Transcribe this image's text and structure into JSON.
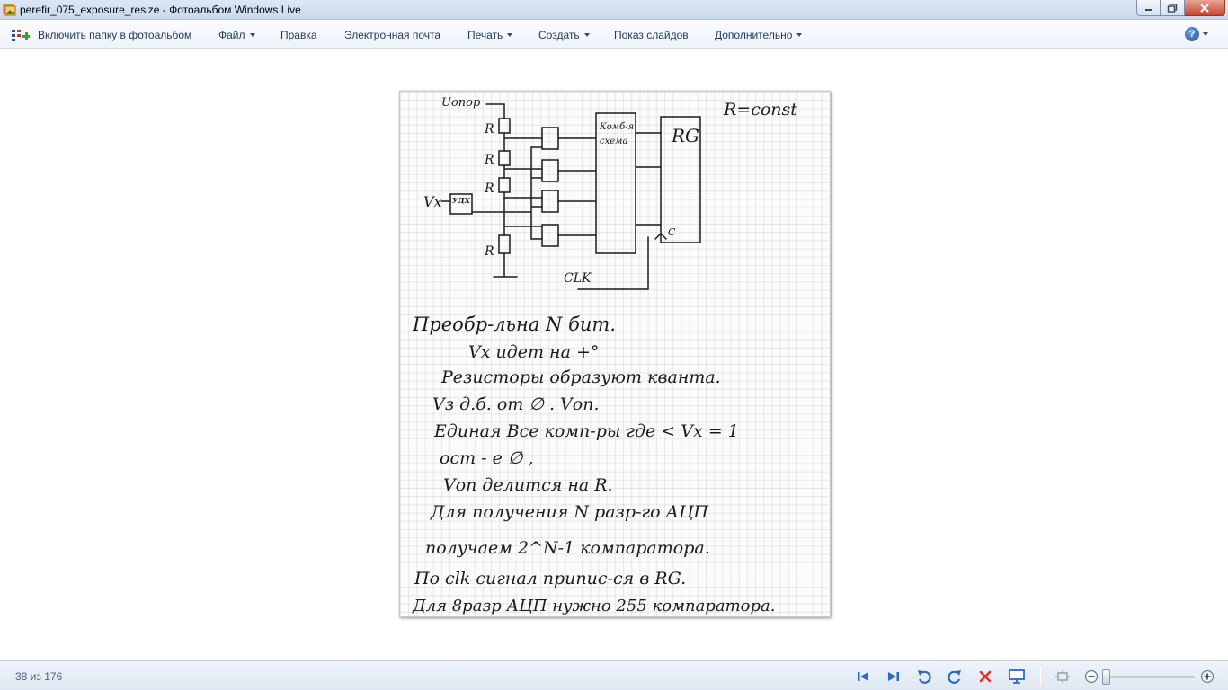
{
  "window": {
    "title": "perefir_075_exposure_resize - Фотоальбом Windows Live"
  },
  "toolbar": {
    "include_folder": "Включить папку в фотоальбом",
    "file": "Файл",
    "edit": "Правка",
    "email": "Электронная почта",
    "print": "Печать",
    "create": "Создать",
    "slideshow": "Показ слайдов",
    "more": "Дополнительно",
    "help_symbol": "?"
  },
  "photo": {
    "label_uop": "Uопор",
    "label_r_const": "R=const",
    "label_r": "R",
    "label_rg": "RG",
    "label_komb": "Комб-я",
    "label_skhema": "схема",
    "label_vx": "Vх",
    "label_udv": "УДХ",
    "label_c": "C",
    "label_clk": "CLK",
    "notes": [
      "Преобр-льна N бит.",
      "Vx идет на +°",
      "Резисторы образуют кванта.",
      "Vз д.б. от ∅ . Vоп.",
      "Единая Все комп-ры где < Vx = 1",
      "ост - е ∅ ,",
      "Vоп делится на R.",
      "Для получения N разр-го АЦП",
      "получаем 2^N-1 компаратора.",
      "По clk сигнал припис-ся в RG.",
      "Для 8разр АЦП нужно 255 компаратора."
    ]
  },
  "statusbar": {
    "counter": "38 из 176"
  },
  "colors": {
    "accent": "#1e395b",
    "nav_blue": "#2a6bc2",
    "delete_red": "#d9342b"
  }
}
